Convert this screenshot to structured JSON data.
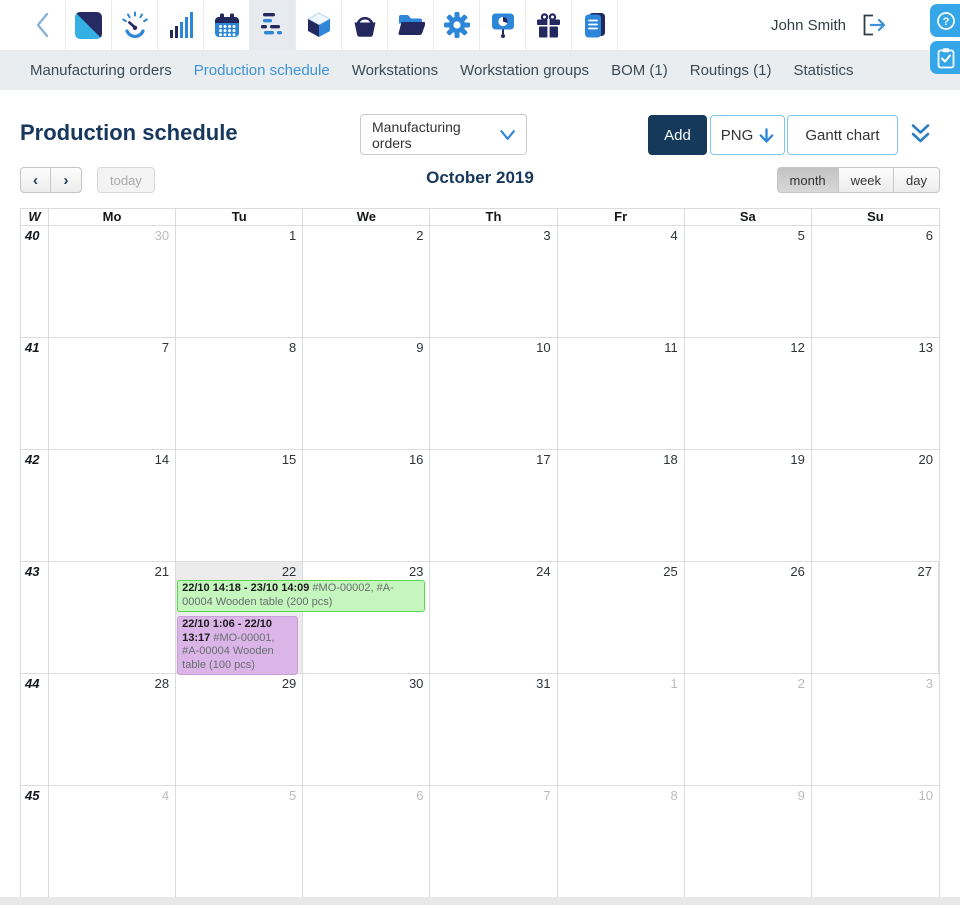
{
  "topbar": {
    "user_name": "John Smith",
    "icons": [
      "back-icon",
      "app-logo",
      "dashboard-icon",
      "statistics-icon",
      "calendar-icon",
      "production-schedule-icon",
      "stock-icon",
      "procurement-icon",
      "documents-icon",
      "settings-icon",
      "presentation-icon",
      "gift-icon",
      "notes-icon",
      "logout-icon"
    ],
    "active_icon": "production-schedule-icon"
  },
  "help_buttons": [
    "help-icon",
    "tasks-icon"
  ],
  "nav": {
    "items": [
      {
        "label": "Manufacturing orders",
        "active": false
      },
      {
        "label": "Production schedule",
        "active": true
      },
      {
        "label": "Workstations",
        "active": false
      },
      {
        "label": "Workstation groups",
        "active": false
      },
      {
        "label": "BOM (1)",
        "active": false
      },
      {
        "label": "Routings (1)",
        "active": false
      },
      {
        "label": "Statistics",
        "active": false
      }
    ]
  },
  "header": {
    "title": "Production schedule",
    "select_value": "Manufacturing orders",
    "add_label": "Add",
    "png_label": "PNG",
    "gantt_label": "Gantt chart"
  },
  "calendar": {
    "title": "October 2019",
    "today_label": "today",
    "prev_label": "‹",
    "next_label": "›",
    "views": [
      "month",
      "week",
      "day"
    ],
    "active_view": "month",
    "day_headers": [
      "W",
      "Mo",
      "Tu",
      "We",
      "Th",
      "Fr",
      "Sa",
      "Su"
    ],
    "weeks": [
      {
        "num": "40",
        "days": [
          {
            "n": "30",
            "out": true
          },
          {
            "n": "1"
          },
          {
            "n": "2"
          },
          {
            "n": "3"
          },
          {
            "n": "4"
          },
          {
            "n": "5"
          },
          {
            "n": "6"
          }
        ]
      },
      {
        "num": "41",
        "days": [
          {
            "n": "7"
          },
          {
            "n": "8"
          },
          {
            "n": "9"
          },
          {
            "n": "10"
          },
          {
            "n": "11"
          },
          {
            "n": "12"
          },
          {
            "n": "13"
          }
        ]
      },
      {
        "num": "42",
        "days": [
          {
            "n": "14"
          },
          {
            "n": "15"
          },
          {
            "n": "16"
          },
          {
            "n": "17"
          },
          {
            "n": "18"
          },
          {
            "n": "19"
          },
          {
            "n": "20"
          }
        ]
      },
      {
        "num": "43",
        "days": [
          {
            "n": "21"
          },
          {
            "n": "22",
            "today": true
          },
          {
            "n": "23"
          },
          {
            "n": "24"
          },
          {
            "n": "25"
          },
          {
            "n": "26"
          },
          {
            "n": "27"
          }
        ]
      },
      {
        "num": "44",
        "days": [
          {
            "n": "28"
          },
          {
            "n": "29"
          },
          {
            "n": "30"
          },
          {
            "n": "31"
          },
          {
            "n": "1",
            "out": true
          },
          {
            "n": "2",
            "out": true
          },
          {
            "n": "3",
            "out": true
          }
        ]
      },
      {
        "num": "45",
        "days": [
          {
            "n": "4",
            "out": true
          },
          {
            "n": "5",
            "out": true
          },
          {
            "n": "6",
            "out": true
          },
          {
            "n": "7",
            "out": true
          },
          {
            "n": "8",
            "out": true
          },
          {
            "n": "9",
            "out": true
          },
          {
            "n": "10",
            "out": true
          }
        ]
      }
    ],
    "events": [
      {
        "time": "22/10 14:18 - 23/10 14:09",
        "title": "#MO-00002, #A-00004 Wooden table (200 pcs)",
        "color": "green",
        "week": 3,
        "day": 1,
        "span": 2
      },
      {
        "time": "22/10 1:06 - 22/10 13:17",
        "title": "#MO-00001, #A-00004 Wooden table (100 pcs)",
        "color": "purple",
        "week": 3,
        "day": 1,
        "span": 1
      }
    ]
  },
  "colors": {
    "green_bg": "#c5f6bd",
    "green_border": "#5ed455",
    "purple_bg": "#dcb5e8",
    "purple_border": "#c9a0da",
    "accent_blue": "#2e86d8",
    "brand_navy": "#23285f",
    "title_navy": "#17375c",
    "nav_active_blue": "#3f93d9",
    "today_bg": "#ececec",
    "help_button_bg": "#35a7e8"
  }
}
